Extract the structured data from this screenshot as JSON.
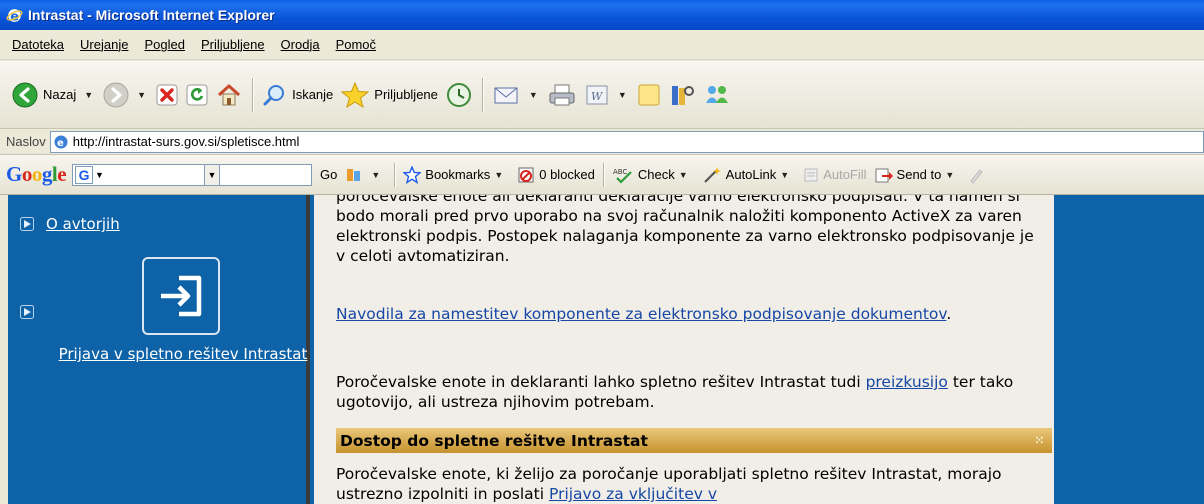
{
  "window": {
    "title": "Intrastat - Microsoft Internet Explorer"
  },
  "menu": [
    "Datoteka",
    "Urejanje",
    "Pogled",
    "Priljubljene",
    "Orodja",
    "Pomoč"
  ],
  "toolbar": {
    "back": "Nazaj",
    "search": "Iskanje",
    "favorites": "Priljubljene"
  },
  "address": {
    "label": "Naslov",
    "url": "http://intrastat-surs.gov.si/spletisce.html"
  },
  "googlebar": {
    "logo": "Google",
    "go": "Go",
    "bookmarks": "Bookmarks",
    "blocked": "0 blocked",
    "check": "Check",
    "autolink": "AutoLink",
    "autofill": "AutoFill",
    "sendto": "Send to"
  },
  "sidebar": {
    "about_link": "O avtorjih",
    "login_caption": "Prijava v spletno rešitev Intrastat"
  },
  "content": {
    "p1": "poročevalske enote ali deklaranti deklaracije varno elektronsko podpisati. V ta namen si bodo morali pred prvo uporabo na svoj računalnik naložiti komponento ActiveX za varen elektronski podpis. Postopek nalaganja komponente za varno elektronsko podpisovanje je v celoti avtomatiziran.",
    "p2_link": "Navodila za namestitev komponente za elektronsko podpisovanje dokumentov",
    "p2_tail": ".",
    "p3_head": "Poročevalske enote in deklaranti lahko spletno rešitev Intrastat tudi ",
    "p3_link": "preizkusijo",
    "p3_tail": " ter tako ugotovijo, ali ustreza njihovim potrebam.",
    "section_title": "Dostop do spletne rešitve Intrastat",
    "p4_head": "Poročevalske enote, ki želijo za poročanje uporabljati spletno rešitev Intrastat, morajo ustrezno izpolniti in poslati ",
    "p4_link": "Prijavo za vključitev v"
  },
  "colors": {
    "page_blue": "#0e63a8",
    "content_bg": "#f0eee6",
    "section_gold": "#c7922e",
    "link": "#1747a6"
  }
}
